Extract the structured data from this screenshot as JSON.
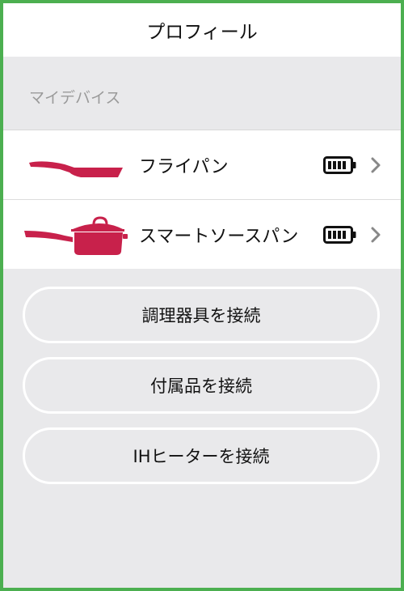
{
  "header": {
    "title": "プロフィール"
  },
  "section": {
    "title": "マイデバイス"
  },
  "devices": [
    {
      "name": "フライパン",
      "icon": "frying-pan-icon"
    },
    {
      "name": "スマートソースパン",
      "icon": "saucepan-icon"
    }
  ],
  "buttons": {
    "connect_cookware": "調理器具を接続",
    "connect_accessory": "付属品を接続",
    "connect_ih_heater": "IHヒーターを接続"
  },
  "colors": {
    "accent_pan": "#c8214b",
    "frame": "#4caf50",
    "background": "#e9e9eb"
  }
}
